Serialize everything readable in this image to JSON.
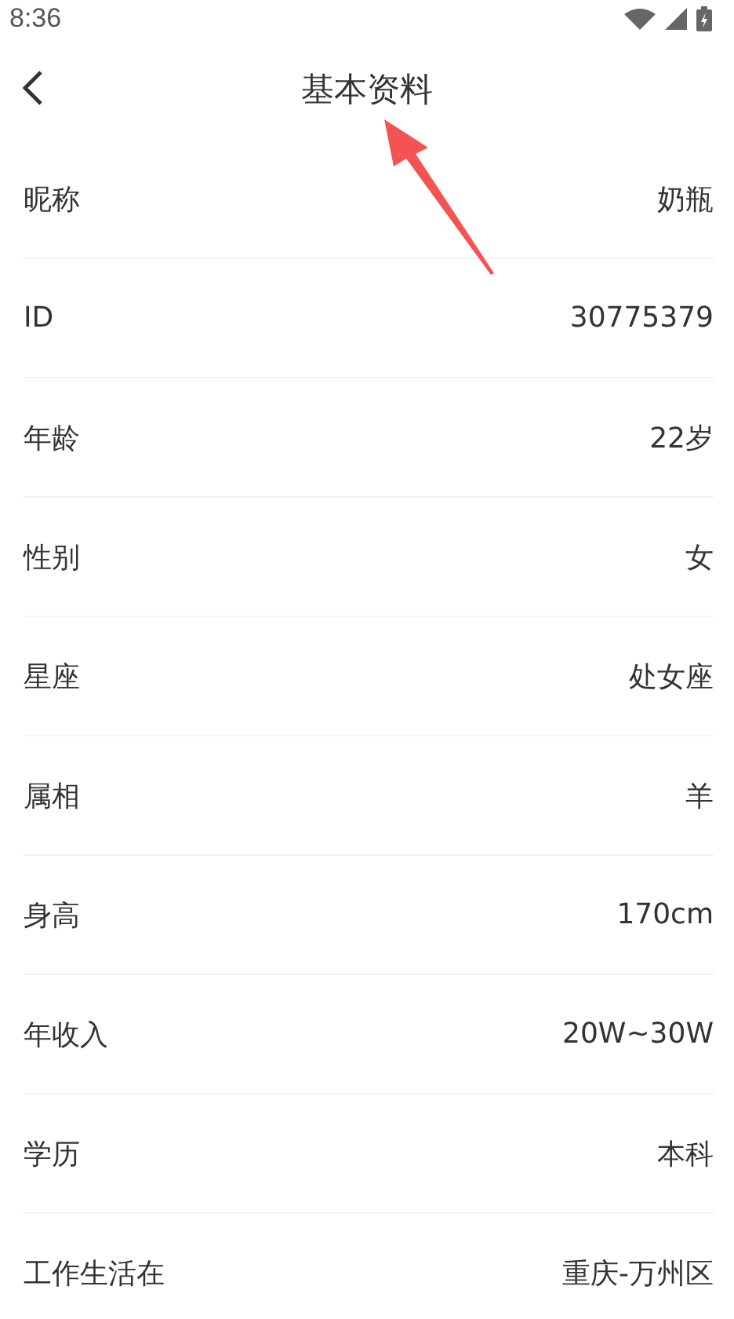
{
  "status_bar": {
    "time": "8:36"
  },
  "header": {
    "title": "基本资料"
  },
  "fields": [
    {
      "label": "昵称",
      "value": "奶瓶"
    },
    {
      "label": "ID",
      "value": "30775379"
    },
    {
      "label": "年龄",
      "value": "22岁"
    },
    {
      "label": "性别",
      "value": "女"
    },
    {
      "label": "星座",
      "value": "处女座"
    },
    {
      "label": "属相",
      "value": "羊"
    },
    {
      "label": "身高",
      "value": "170cm"
    },
    {
      "label": "年收入",
      "value": "20W~30W"
    },
    {
      "label": "学历",
      "value": "本科"
    },
    {
      "label": "工作生活在",
      "value": "重庆-万州区"
    }
  ]
}
